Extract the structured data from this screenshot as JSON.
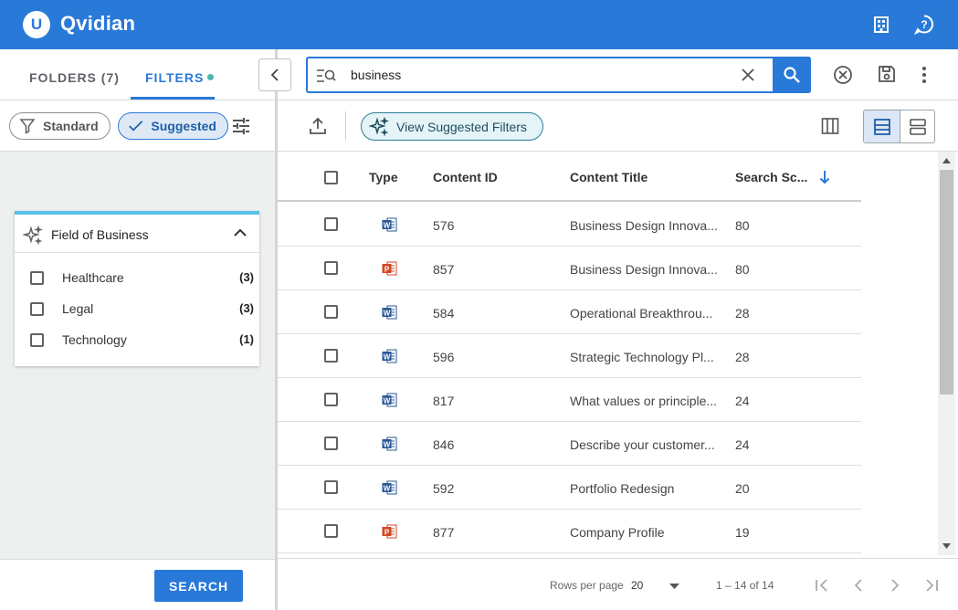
{
  "app": {
    "brand": "Qvidian",
    "logo_letter": "U"
  },
  "left_panel": {
    "tabs": [
      {
        "label": "FOLDERS (7)"
      },
      {
        "label": "FILTERS"
      }
    ],
    "chips": {
      "standard": "Standard",
      "suggested": "Suggested"
    },
    "filter_group": {
      "title": "Field of Business",
      "items": [
        {
          "label": "Healthcare",
          "count": "(3)"
        },
        {
          "label": "Legal",
          "count": "(3)"
        },
        {
          "label": "Technology",
          "count": "(1)"
        }
      ]
    },
    "search_button": "SEARCH"
  },
  "search": {
    "value": "business"
  },
  "toolbar": {
    "suggested_filters_label": "View Suggested Filters"
  },
  "table": {
    "columns": [
      "Type",
      "Content ID",
      "Content Title",
      "Search Sc..."
    ],
    "rows": [
      {
        "type": "word",
        "id": "576",
        "title": "Business Design Innova...",
        "score": "80"
      },
      {
        "type": "ppt",
        "id": "857",
        "title": "Business Design Innova...",
        "score": "80"
      },
      {
        "type": "word",
        "id": "584",
        "title": "Operational Breakthrou...",
        "score": "28"
      },
      {
        "type": "word",
        "id": "596",
        "title": "Strategic Technology Pl...",
        "score": "28"
      },
      {
        "type": "word",
        "id": "817",
        "title": "What values or principle...",
        "score": "24"
      },
      {
        "type": "word",
        "id": "846",
        "title": "Describe your customer...",
        "score": "24"
      },
      {
        "type": "word",
        "id": "592",
        "title": "Portfolio Redesign",
        "score": "20"
      },
      {
        "type": "ppt",
        "id": "877",
        "title": "Company Profile",
        "score": "19"
      }
    ]
  },
  "pagination": {
    "rows_per_page_label": "Rows per page",
    "rows_per_page": "20",
    "range": "1 – 14 of 14"
  },
  "colors": {
    "primary": "#2979d9",
    "word": "#2b5797",
    "ppt": "#d24726",
    "accent": "#5bc0e8"
  }
}
